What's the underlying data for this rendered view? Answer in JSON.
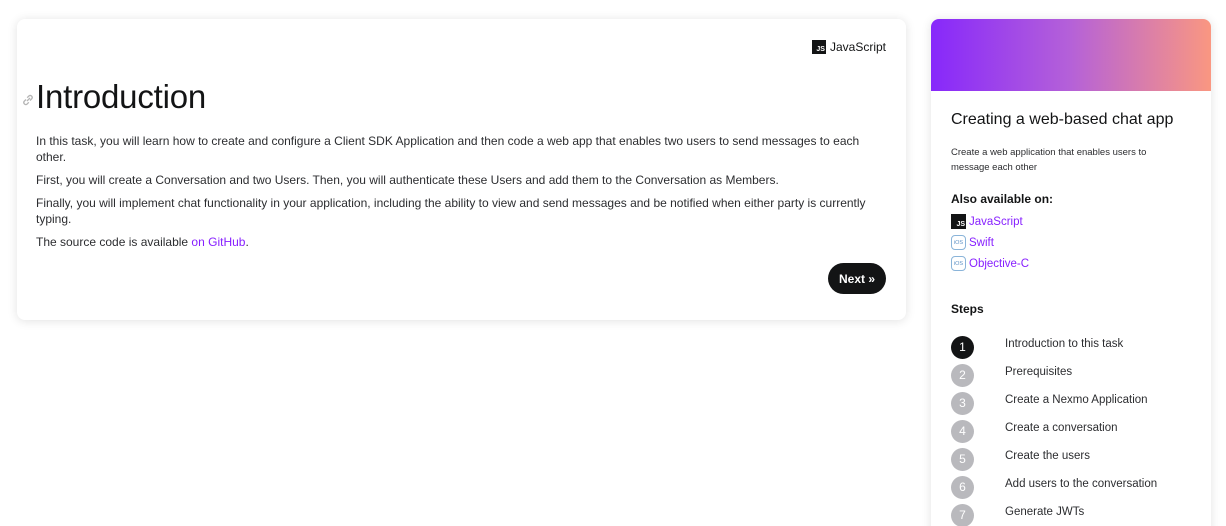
{
  "main": {
    "language_badge": {
      "icon_text": "JS",
      "label": "JavaScript"
    },
    "title": "Introduction",
    "paragraphs": [
      "In this task, you will learn how to create and configure a Client SDK Application and then code a web app that enables two users to send messages to each other.",
      "First, you will create a Conversation and two Users. Then, you will authenticate these Users and add them to the Conversation as Members.",
      "Finally, you will implement chat functionality in your application, including the ability to view and send messages and be notified when either party is currently typing."
    ],
    "source_prefix": "The source code is available ",
    "source_link": "on GitHub",
    "source_suffix": ".",
    "next_label": "Next »"
  },
  "sidebar": {
    "banner_colors": [
      "#8728fb",
      "#b561d8",
      "#fa9781"
    ],
    "title": "Creating a web-based chat app",
    "description": "Create a web application that enables users to message each other",
    "available_title": "Also available on:",
    "available": [
      {
        "icon": "js-icon",
        "icon_text": "JS",
        "label": "JavaScript"
      },
      {
        "icon": "ios-icon",
        "icon_text": "iOS",
        "label": "Swift"
      },
      {
        "icon": "ios-icon",
        "icon_text": "iOS",
        "label": "Objective-C"
      }
    ],
    "steps_title": "Steps",
    "steps": [
      {
        "num": "1",
        "label": "Introduction to this task",
        "active": true
      },
      {
        "num": "2",
        "label": "Prerequisites"
      },
      {
        "num": "3",
        "label": "Create a Nexmo Application"
      },
      {
        "num": "4",
        "label": "Create a conversation"
      },
      {
        "num": "5",
        "label": "Create the users"
      },
      {
        "num": "6",
        "label": "Add users to the conversation"
      },
      {
        "num": "7",
        "label": "Generate JWTs"
      }
    ]
  },
  "colors": {
    "accent": "#871fff",
    "dark": "#131415",
    "step_inactive": "#b9b9bd"
  }
}
